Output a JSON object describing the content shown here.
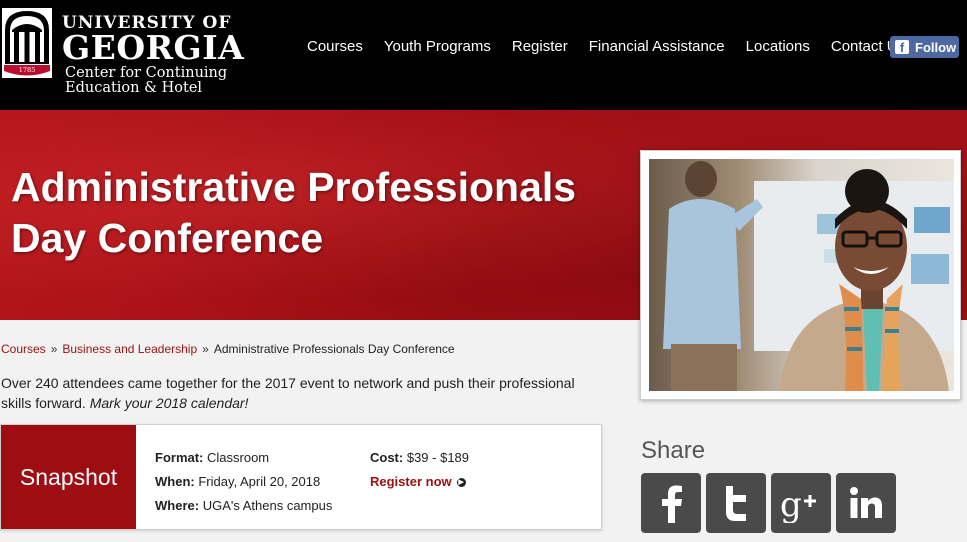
{
  "header": {
    "logo": {
      "year": "1785",
      "university": "UNIVERSITY OF",
      "georgia": "GEORGIA",
      "center_line1": "Center for Continuing",
      "center_line2": "Education & Hotel"
    },
    "nav": [
      "Courses",
      "Youth Programs",
      "Register",
      "Financial Assistance",
      "Locations",
      "Contact Us"
    ],
    "follow_label": "Follow"
  },
  "banner": {
    "title": "Administrative Professionals Day Conference"
  },
  "breadcrumb": {
    "items": [
      "Courses",
      "Business and Leadership"
    ],
    "current": "Administrative Professionals Day Conference",
    "separator": "»"
  },
  "intro": {
    "text": "Over 240 attendees came together for the 2017 event to network and push their professional skills forward.",
    "emphasis": "Mark your 2018 calendar!"
  },
  "snapshot": {
    "heading": "Snapshot",
    "format_label": "Format:",
    "format_value": "Classroom",
    "when_label": "When:",
    "when_value": "Friday, April 20, 2018",
    "where_label": "Where:",
    "where_value": "UGA's Athens campus",
    "cost_label": "Cost:",
    "cost_value": "$39 - $189",
    "register_label": "Register now"
  },
  "share": {
    "label": "Share",
    "buttons": [
      "facebook-icon",
      "twitter-icon",
      "google-plus-icon",
      "linkedin-icon"
    ]
  },
  "colors": {
    "brand_red": "#9e0d12",
    "link_red": "#9c1010",
    "facebook_blue": "#4e69a2",
    "share_gray": "#4a4a4a"
  }
}
